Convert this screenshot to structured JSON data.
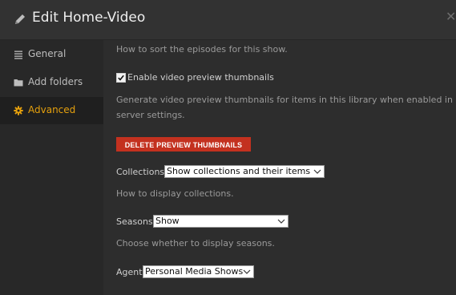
{
  "dialog": {
    "title": "Edit Home-Video",
    "close_glyph": "✕"
  },
  "sidebar": {
    "items": [
      {
        "label": "General",
        "icon": "list-icon"
      },
      {
        "label": "Add folders",
        "icon": "folder-icon"
      },
      {
        "label": "Advanced",
        "icon": "gear-icon",
        "active": true
      }
    ]
  },
  "content": {
    "episode_sort_help": "How to sort the episodes for this show.",
    "preview_thumbnails": {
      "label": "Enable video preview thumbnails",
      "checked": true,
      "help_line1": "Generate video preview thumbnails for items in this library when enabled in",
      "help_line2": "server settings."
    },
    "delete_button": "DELETE PREVIEW THUMBNAILS",
    "collections": {
      "label": "Collections",
      "value": "Show collections and their items",
      "help": "How to display collections."
    },
    "seasons": {
      "label": "Seasons",
      "value": "Show",
      "help": "Choose whether to display seasons."
    },
    "agent": {
      "label": "Agent",
      "value": "Personal Media Shows"
    }
  },
  "colors": {
    "accent": "#e5a00d",
    "danger": "#c3311f"
  }
}
